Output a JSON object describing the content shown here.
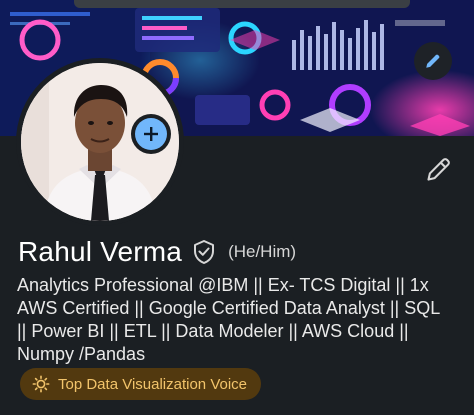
{
  "profile": {
    "name": "Rahul Verma",
    "pronouns": "(He/Him)",
    "headline": "Analytics Professional @IBM || Ex- TCS Digital || 1x\nAWS Certified || Google Certified Data Analyst || SQL\n|| Power BI || ETL || Data Modeler || AWS Cloud ||\nNumpy /Pandas",
    "badge": "Top Data Visualization Voice"
  },
  "icons": {
    "banner_edit": "pencil-icon",
    "profile_edit": "pencil-icon",
    "add_photo": "plus-icon",
    "verified": "shield-check-icon",
    "voice": "sun-icon"
  },
  "colors": {
    "background": "#1b1f23",
    "accent_blue": "#71b7fb",
    "badge_bg": "#52390f",
    "badge_text": "#f2c46b"
  }
}
